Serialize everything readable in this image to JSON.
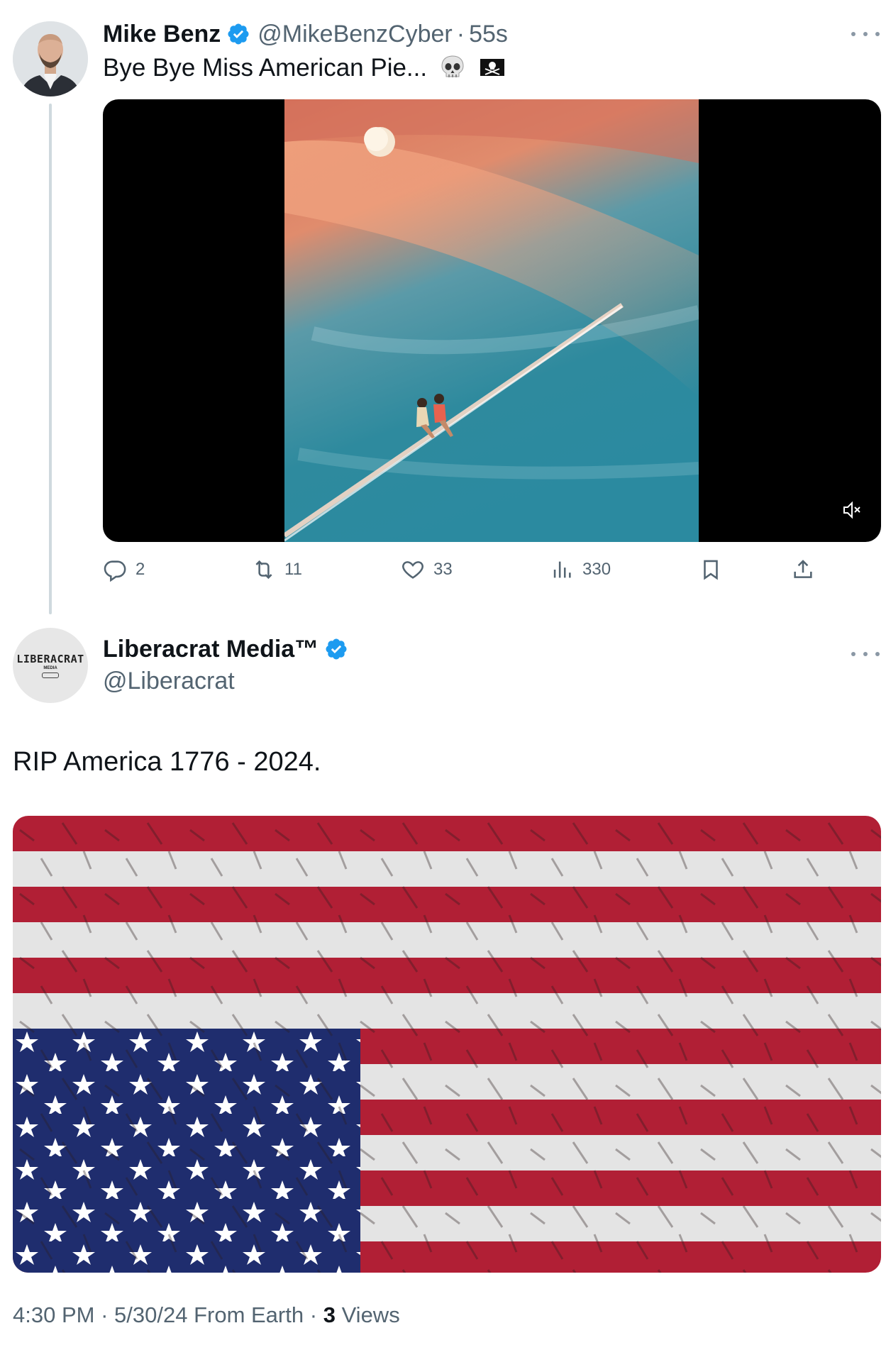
{
  "post1": {
    "author_name": "Mike Benz",
    "handle": "@MikeBenzCyber",
    "separator": "·",
    "time": "55s",
    "text": "Bye Bye Miss American Pie...",
    "emojis": [
      "skull-emoji",
      "pirate-flag-emoji"
    ],
    "media": "video",
    "stats": {
      "replies": "2",
      "reposts": "11",
      "likes": "33",
      "views": "330"
    }
  },
  "post2": {
    "author_name": "Liberacrat Media™",
    "handle": "@Liberacrat",
    "avatar_logo": "LIBERACRAT",
    "avatar_logo_sub": "MEDIA",
    "text": "RIP America 1776 - 2024.",
    "media": "image",
    "meta": {
      "time": "4:30 PM",
      "sep1": "·",
      "date_location": "5/30/24 From Earth",
      "sep2": "·",
      "views_count": "3",
      "views_label": "Views"
    }
  },
  "colors": {
    "verified": "#1d9bf0",
    "secondary_text": "#536471",
    "primary_text": "#0f1419"
  }
}
